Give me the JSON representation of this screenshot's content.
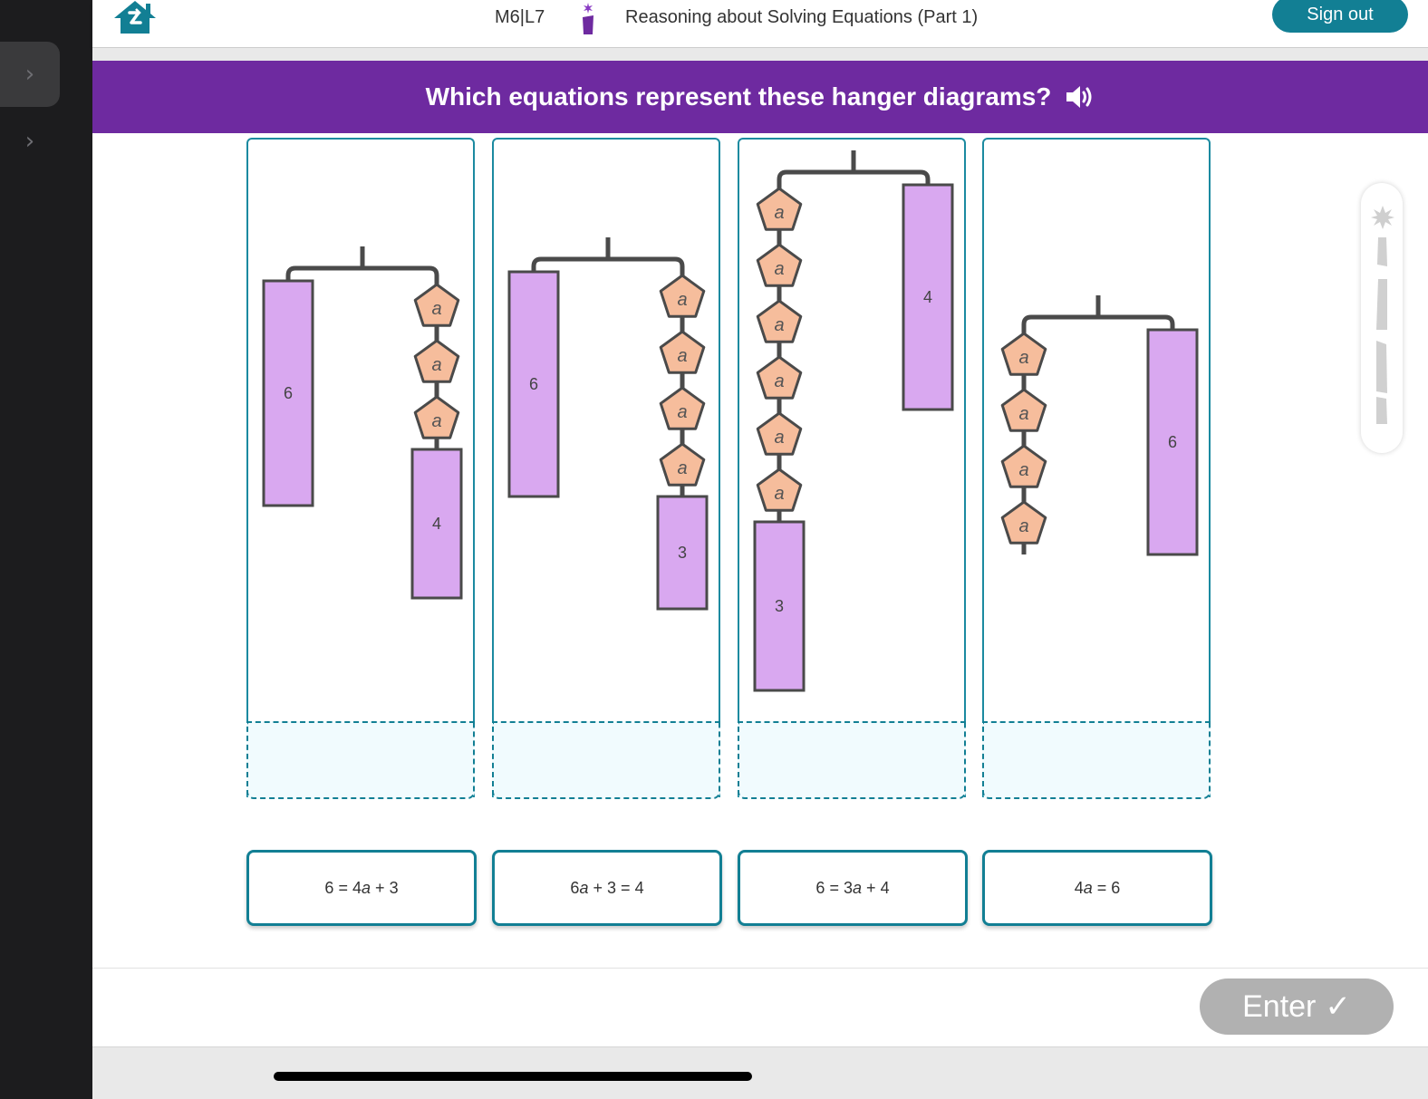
{
  "header": {
    "lesson_code": "M6|L7",
    "lesson_title": "Reasoning about Solving Equations (Part 1)",
    "sign_out_label": "Sign out",
    "home_icon": "home-icon",
    "info_icon": "info-icon"
  },
  "sidebar": {
    "items": [
      {
        "icon": "chevron-right-icon",
        "glyph": "›",
        "active": true
      },
      {
        "icon": "chevron-right-icon",
        "glyph": "›",
        "active": false
      }
    ]
  },
  "question": {
    "prompt": "Which equations represent these hanger diagrams?",
    "audio_icon": "speaker-icon"
  },
  "diagrams": [
    {
      "left": [
        {
          "type": "box",
          "value": "6"
        }
      ],
      "right": [
        {
          "type": "a"
        },
        {
          "type": "a"
        },
        {
          "type": "a"
        },
        {
          "type": "box",
          "value": "4"
        }
      ]
    },
    {
      "left": [
        {
          "type": "box",
          "value": "6"
        }
      ],
      "right": [
        {
          "type": "a"
        },
        {
          "type": "a"
        },
        {
          "type": "a"
        },
        {
          "type": "a"
        },
        {
          "type": "box",
          "value": "3"
        }
      ]
    },
    {
      "left": [
        {
          "type": "a"
        },
        {
          "type": "a"
        },
        {
          "type": "a"
        },
        {
          "type": "a"
        },
        {
          "type": "a"
        },
        {
          "type": "a"
        },
        {
          "type": "box",
          "value": "3"
        }
      ],
      "right": [
        {
          "type": "box",
          "value": "4"
        }
      ]
    },
    {
      "left": [
        {
          "type": "a"
        },
        {
          "type": "a"
        },
        {
          "type": "a"
        },
        {
          "type": "a"
        }
      ],
      "right": [
        {
          "type": "box",
          "value": "6"
        }
      ]
    }
  ],
  "variable_label": "a",
  "cards": [
    {
      "label": "6 = 4a + 3"
    },
    {
      "label": "6a + 3 = 4"
    },
    {
      "label": "6 = 3a + 4"
    },
    {
      "label": "4a = 6"
    }
  ],
  "footer": {
    "enter_label": "Enter",
    "enter_icon": "✓"
  },
  "progress": {
    "steps_total": 4,
    "steps_completed": 0
  },
  "colors": {
    "accent": "#127f94",
    "banner": "#6e2aa0",
    "box_fill": "#d9a8f0",
    "shape_fill": "#f6bd9c",
    "enter_disabled": "#b1b1b1"
  }
}
